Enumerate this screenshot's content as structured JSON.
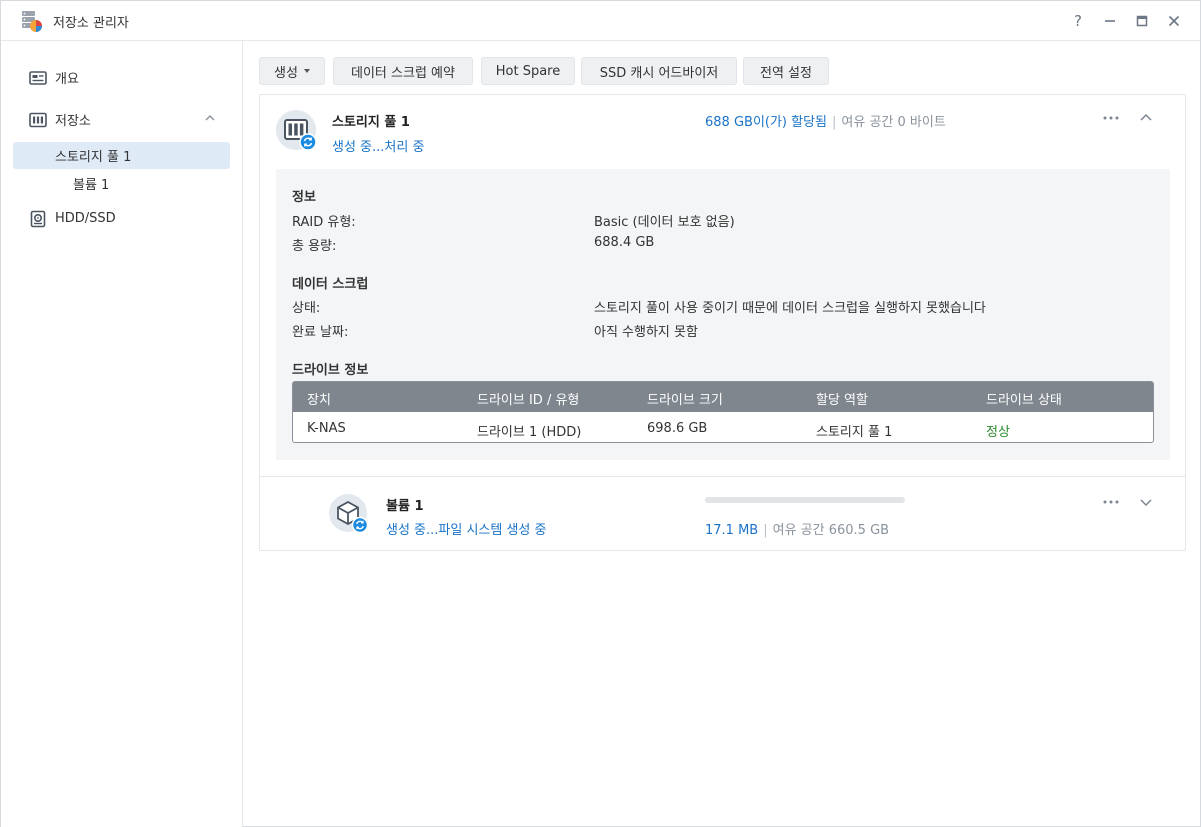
{
  "window": {
    "title": "저장소 관리자",
    "controls": {
      "help": "?",
      "minimize": "—",
      "maximize": "□",
      "close": "✕"
    }
  },
  "sidebar": {
    "items": [
      {
        "label": "개요",
        "icon": "overview-icon"
      },
      {
        "label": "저장소",
        "icon": "storage-icon",
        "expanded": true
      },
      {
        "label": "스토리지 풀 1",
        "active": true
      },
      {
        "label": "볼륨 1"
      },
      {
        "label": "HDD/SSD",
        "icon": "hdd-icon"
      }
    ]
  },
  "toolbar": {
    "create": "생성",
    "data_scrub_schedule": "데이터 스크럽 예약",
    "hot_spare": "Hot Spare",
    "ssd_cache_advisor": "SSD 캐시 어드바이저",
    "global_settings": "전역 설정"
  },
  "pool": {
    "title": "스토리지 풀 1",
    "status": "생성 중...처리 중",
    "allocated": "688 GB이(가) 할당됨",
    "separator": "|",
    "free": "여유 공간 0 바이트",
    "info": {
      "section_title": "정보",
      "raid_label": "RAID 유형:",
      "raid_value": "Basic (데이터 보호 없음)",
      "capacity_label": "총 용량:",
      "capacity_value": "688.4 GB"
    },
    "scrub": {
      "section_title": "데이터 스크럽",
      "status_label": "상태:",
      "status_value": "스토리지 풀이 사용 중이기 때문에 데이터 스크럽을 실행하지 못했습니다",
      "completed_label": "완료 날짜:",
      "completed_value": "아직 수행하지 못함"
    },
    "drives": {
      "section_title": "드라이브 정보",
      "headers": [
        "장치",
        "드라이브 ID / 유형",
        "드라이브 크기",
        "할당 역할",
        "드라이브 상태"
      ],
      "rows": [
        [
          "K-NAS",
          "드라이브 1 (HDD)",
          "698.6 GB",
          "스토리지 풀 1",
          "정상"
        ]
      ]
    }
  },
  "volume": {
    "title": "볼륨 1",
    "status": "생성 중...파일 시스템 생성 중",
    "used": "17.1 MB",
    "separator": "|",
    "free": "여유 공간 660.5 GB",
    "usage_fraction": 0.0
  },
  "colors": {
    "accent_blue": "#1a73c7",
    "status_ok": "#2e8b2e",
    "table_header": "#7f868e",
    "active_nav": "#dfeaf7"
  }
}
